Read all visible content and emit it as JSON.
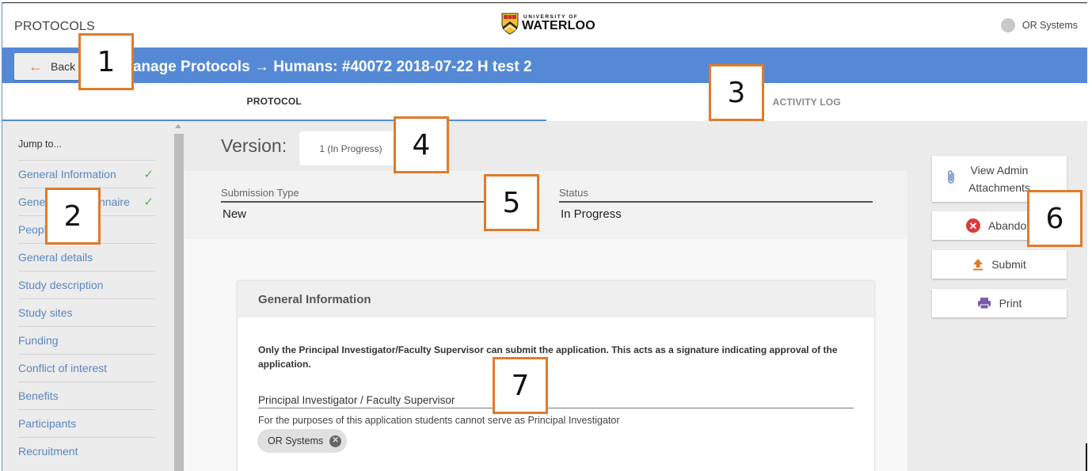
{
  "header": {
    "app_title": "PROTOCOLS",
    "logo": {
      "small": "UNIVERSITY OF",
      "big": "WATERLOO",
      "icon": "waterloo-shield-icon"
    },
    "user": {
      "name": "OR Systems",
      "icon": "avatar-icon"
    }
  },
  "titlebar": {
    "back_label": "Back",
    "back_icon": "arrow-left-icon",
    "title": "Manage Protocols → Humans: #40072 2018-07-22 H test 2"
  },
  "tabs": [
    {
      "label": "PROTOCOL",
      "active": true
    },
    {
      "label": "ACTIVITY LOG",
      "active": false
    }
  ],
  "sidebar": {
    "jump_label": "Jump to...",
    "items": [
      {
        "label": "General Information",
        "complete": true
      },
      {
        "label": "General Questionnaire",
        "complete": true
      },
      {
        "label": "People",
        "complete": false
      },
      {
        "label": "General details",
        "complete": false
      },
      {
        "label": "Study description",
        "complete": false
      },
      {
        "label": "Study sites",
        "complete": false
      },
      {
        "label": "Funding",
        "complete": false
      },
      {
        "label": "Conflict of interest",
        "complete": false
      },
      {
        "label": "Benefits",
        "complete": false
      },
      {
        "label": "Participants",
        "complete": false
      },
      {
        "label": "Recruitment",
        "complete": false
      }
    ],
    "check_glyph": "✓"
  },
  "version": {
    "label": "Version:",
    "selected": "1 (In Progress)"
  },
  "meta": {
    "submission_type": {
      "label": "Submission Type",
      "value": "New"
    },
    "status": {
      "label": "Status",
      "value": "In Progress"
    }
  },
  "actions": {
    "attachments": {
      "label_line1": "View Admin",
      "label_line2": "Attachments",
      "icon": "paperclip-icon"
    },
    "abandon": {
      "label": "Abandon",
      "icon": "cancel-circle-icon",
      "glyph": "✕"
    },
    "submit": {
      "label": "Submit",
      "icon": "upload-icon"
    },
    "print": {
      "label": "Print",
      "icon": "printer-icon"
    }
  },
  "card": {
    "title": "General Information",
    "note": "Only the Principal Investigator/Faculty Supervisor can submit the application. This acts as a signature indicating approval of the application.",
    "pi_label": "Principal Investigator / Faculty Supervisor",
    "pi_help": "For the purposes of this application students cannot serve as Principal Investigator",
    "pi_chip": "OR Systems",
    "chip_remove_glyph": "✕"
  },
  "annotations": [
    "1",
    "2",
    "3",
    "4",
    "5",
    "6",
    "7"
  ],
  "colors": {
    "accent": "#5589d6",
    "annotation_border": "#e07b28",
    "check": "#58b658",
    "abandon": "#dc3a3a",
    "submit": "#e07b28",
    "print": "#7a5aa8",
    "link": "#5a86c0"
  }
}
